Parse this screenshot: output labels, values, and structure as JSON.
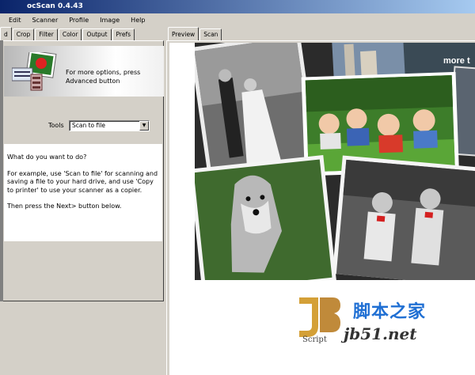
{
  "window": {
    "title": "ocScan 0.4.43"
  },
  "menu": [
    "Edit",
    "Scanner",
    "Profile",
    "Image",
    "Help"
  ],
  "left_tabs": [
    "d",
    "Crop",
    "Filter",
    "Color",
    "Output",
    "Prefs"
  ],
  "right_tabs": [
    "Preview",
    "Scan"
  ],
  "banner": {
    "text": "For more options, press Advanced button"
  },
  "tool": {
    "label": "Tools",
    "value": "Scan to file"
  },
  "help": {
    "p1": "What do you want to do?",
    "p2": "For example, use 'Scan to file' for scanning and saving a file to your hard drive, and use 'Copy to printer' to use your scanner as a copier.",
    "p3": "Then press the Next> button below."
  },
  "preview": {
    "overlay_text": "more t"
  },
  "watermark": {
    "cn": "脚本之家",
    "url": "jb51.net",
    "logo_sub": "Script"
  }
}
